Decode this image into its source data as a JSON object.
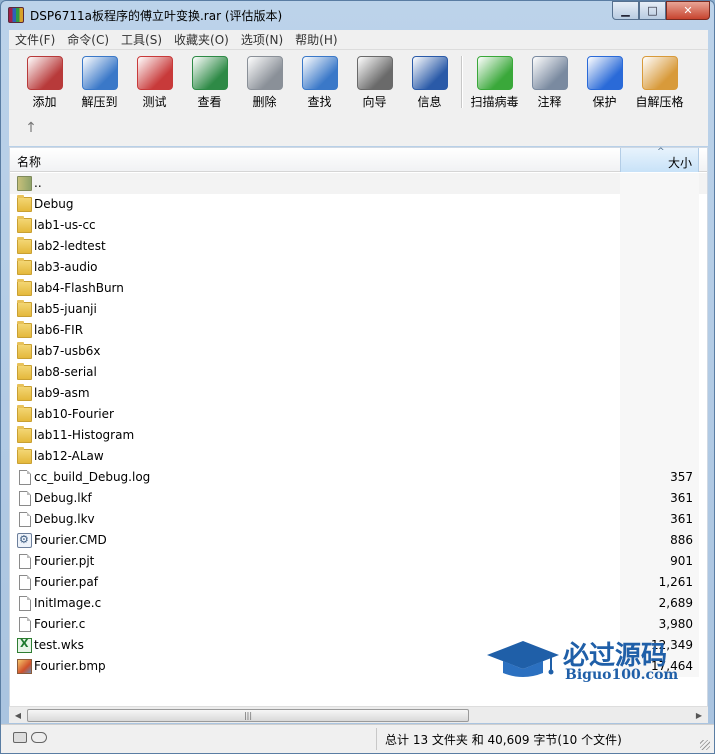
{
  "window": {
    "title": "DSP6711a板程序的傅立叶变换.rar (评估版本)",
    "minimize": "▁",
    "maximize": "□",
    "close": "✕"
  },
  "menu": [
    "文件(F)",
    "命令(C)",
    "工具(S)",
    "收藏夹(O)",
    "选项(N)",
    "帮助(H)"
  ],
  "toolbar": [
    {
      "label": "添加",
      "icon": "add-archive-icon",
      "color": "#b83a3a"
    },
    {
      "label": "解压到",
      "icon": "extract-folder-icon",
      "color": "#3a78c8"
    },
    {
      "label": "测试",
      "icon": "test-clipboard-icon",
      "color": "#c83a3a"
    },
    {
      "label": "查看",
      "icon": "view-book-icon",
      "color": "#2e8a46"
    },
    {
      "label": "删除",
      "icon": "delete-trash-icon",
      "color": "#8a9098"
    },
    {
      "label": "查找",
      "icon": "find-magnifier-icon",
      "color": "#3a78c8"
    },
    {
      "label": "向导",
      "icon": "wizard-wand-icon",
      "color": "#6a6a6a"
    },
    {
      "label": "信息",
      "icon": "info-icon",
      "color": "#2a5aa8"
    },
    {
      "label": "扫描病毒",
      "icon": "virus-scan-icon",
      "color": "#3aa83a"
    },
    {
      "label": "注释",
      "icon": "comment-icon",
      "color": "#7a8aa0"
    },
    {
      "label": "保护",
      "icon": "shield-icon",
      "color": "#2a6ad8"
    },
    {
      "label": "自解压格",
      "icon": "sfx-box-icon",
      "color": "#d89a3a"
    }
  ],
  "up_button": "↑",
  "columns": {
    "name": "名称",
    "size": "大小",
    "sort_arrow": "^"
  },
  "files": [
    {
      "name": "..",
      "type": "parent",
      "size": ""
    },
    {
      "name": "Debug",
      "type": "folder",
      "size": ""
    },
    {
      "name": "lab1-us-cc",
      "type": "folder",
      "size": ""
    },
    {
      "name": "lab2-ledtest",
      "type": "folder",
      "size": ""
    },
    {
      "name": "lab3-audio",
      "type": "folder",
      "size": ""
    },
    {
      "name": "lab4-FlashBurn",
      "type": "folder",
      "size": ""
    },
    {
      "name": "lab5-juanji",
      "type": "folder",
      "size": ""
    },
    {
      "name": "lab6-FIR",
      "type": "folder",
      "size": ""
    },
    {
      "name": "lab7-usb6x",
      "type": "folder",
      "size": ""
    },
    {
      "name": "lab8-serial",
      "type": "folder",
      "size": ""
    },
    {
      "name": "lab9-asm",
      "type": "folder",
      "size": ""
    },
    {
      "name": "lab10-Fourier",
      "type": "folder",
      "size": ""
    },
    {
      "name": "lab11-Histogram",
      "type": "folder",
      "size": ""
    },
    {
      "name": "lab12-ALaw",
      "type": "folder",
      "size": ""
    },
    {
      "name": "cc_build_Debug.log",
      "type": "file",
      "size": "357"
    },
    {
      "name": "Debug.lkf",
      "type": "file",
      "size": "361"
    },
    {
      "name": "Debug.lkv",
      "type": "file",
      "size": "361"
    },
    {
      "name": "Fourier.CMD",
      "type": "cmd",
      "size": "886"
    },
    {
      "name": "Fourier.pjt",
      "type": "file",
      "size": "901"
    },
    {
      "name": "Fourier.paf",
      "type": "file",
      "size": "1,261"
    },
    {
      "name": "InitImage.c",
      "type": "file",
      "size": "2,689"
    },
    {
      "name": "Fourier.c",
      "type": "file",
      "size": "3,980"
    },
    {
      "name": "test.wks",
      "type": "xls",
      "size": "12,349"
    },
    {
      "name": "Fourier.bmp",
      "type": "bmp",
      "size": "17,464"
    }
  ],
  "scrollbar": {
    "left": "◀",
    "right": "▶",
    "grip": "|||"
  },
  "status": {
    "summary": "总计 13 文件夹 和 40,609 字节(10 个文件)"
  },
  "watermark": {
    "title": "必过源码",
    "url": "Biguo100.com"
  }
}
